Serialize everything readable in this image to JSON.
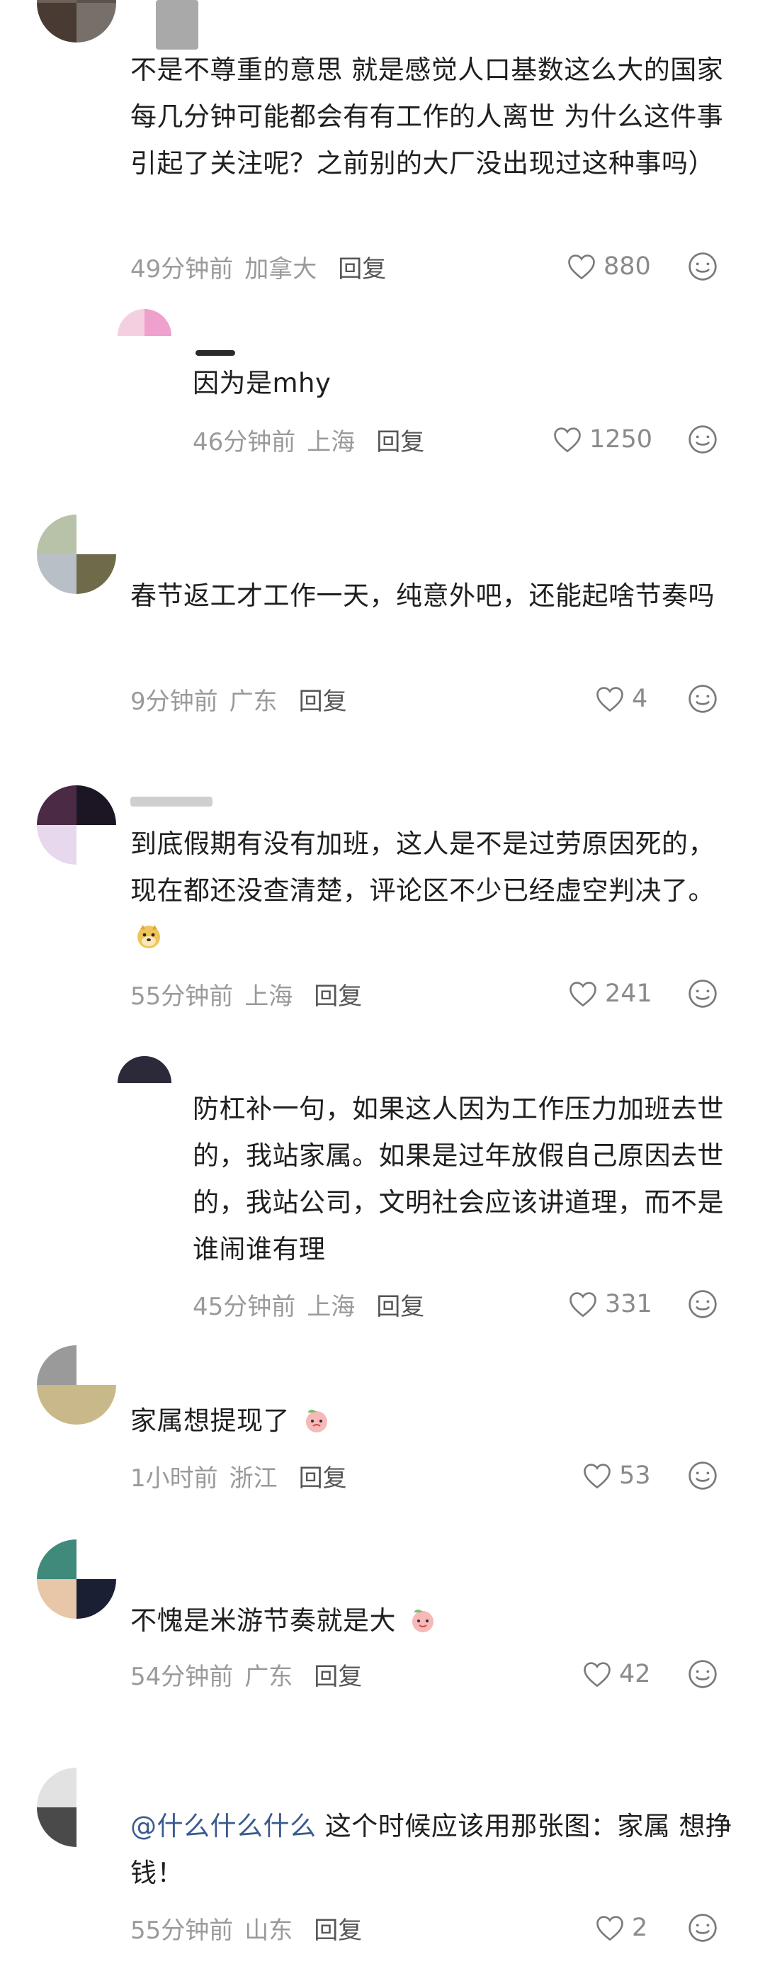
{
  "comments": [
    {
      "text": "不是不尊重的意思 就是感觉人口基数这么大的国家每几分钟可能都会有有工作的人离世 为什么这件事引起了关注呢？之前别的大厂没出现过这种事吗）",
      "time": "49分钟前",
      "location": "加拿大",
      "reply": "回复",
      "likes": "880"
    },
    {
      "text": "因为是mhy",
      "time": "46分钟前",
      "location": "上海",
      "reply": "回复",
      "likes": "1250"
    },
    {
      "text": "春节返工才工作一天，纯意外吧，还能起啥节奏吗",
      "time": "9分钟前",
      "location": "广东",
      "reply": "回复",
      "likes": "4"
    },
    {
      "text": "到底假期有没有加班，这人是不是过劳原因死的，现在都还没查清楚，评论区不少已经虚空判决了。",
      "time": "55分钟前",
      "location": "上海",
      "reply": "回复",
      "likes": "241"
    },
    {
      "text": "防杠补一句，如果这人因为工作压力加班去世的，我站家属。如果是过年放假自己原因去世的，我站公司，文明社会应该讲道理，而不是谁闹谁有理",
      "time": "45分钟前",
      "location": "上海",
      "reply": "回复",
      "likes": "331"
    },
    {
      "text": "家属想提现了",
      "time": "1小时前",
      "location": "浙江",
      "reply": "回复",
      "likes": "53"
    },
    {
      "text": "不愧是米游节奏就是大",
      "time": "54分钟前",
      "location": "广东",
      "reply": "回复",
      "likes": "42"
    },
    {
      "mention": "@什么什么什么",
      "text": " 这个时候应该用那张图：家属 想挣钱！",
      "time": "55分钟前",
      "location": "山东",
      "reply": "回复",
      "likes": "2"
    }
  ],
  "icons": {
    "like": "heart-outline-icon",
    "react": "smiley-face-icon"
  },
  "colors": {
    "meta_gray": "#9a9a9a",
    "mention_blue": "#3b5b8f"
  }
}
